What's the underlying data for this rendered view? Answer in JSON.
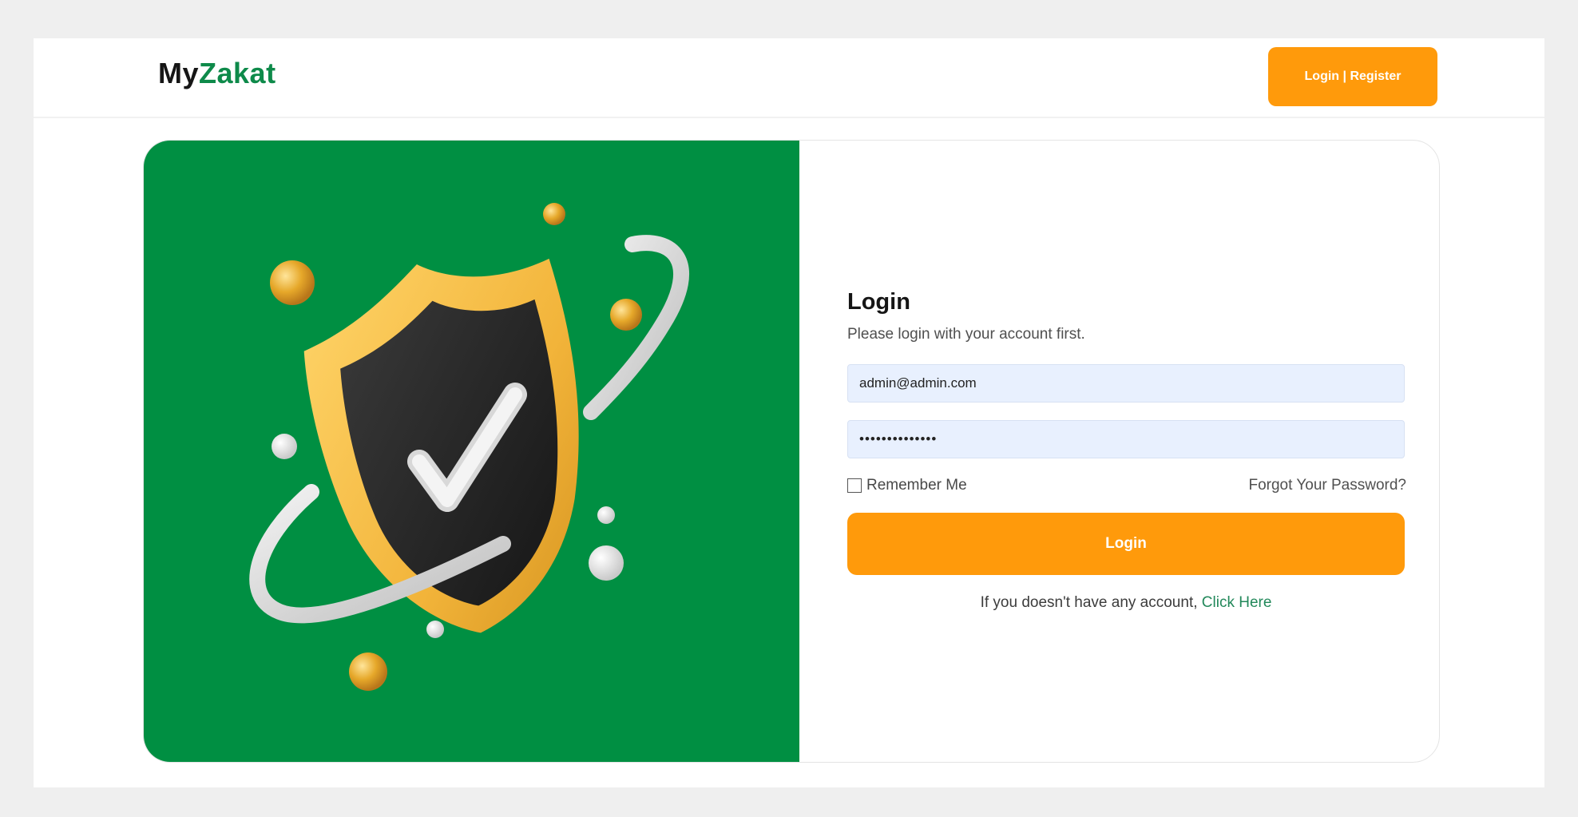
{
  "header": {
    "brand_part1": "My",
    "brand_part2": "Zakat",
    "auth_button": "Login | Register"
  },
  "hero": {
    "illustration": "shield-checkmark-icon",
    "background_color": "#008f42"
  },
  "login_form": {
    "title": "Login",
    "subtitle": "Please login with your account first.",
    "email_value": "admin@admin.com",
    "password_value": "••••••••••••••",
    "remember_label": "Remember Me",
    "forgot_link": "Forgot Your Password?",
    "submit_label": "Login",
    "register_prompt": "If you doesn't have any account,",
    "register_link": "Click Here"
  },
  "colors": {
    "accent_orange": "#ff9a0b",
    "brand_green": "#0e8a4a",
    "hero_green": "#008f42"
  }
}
